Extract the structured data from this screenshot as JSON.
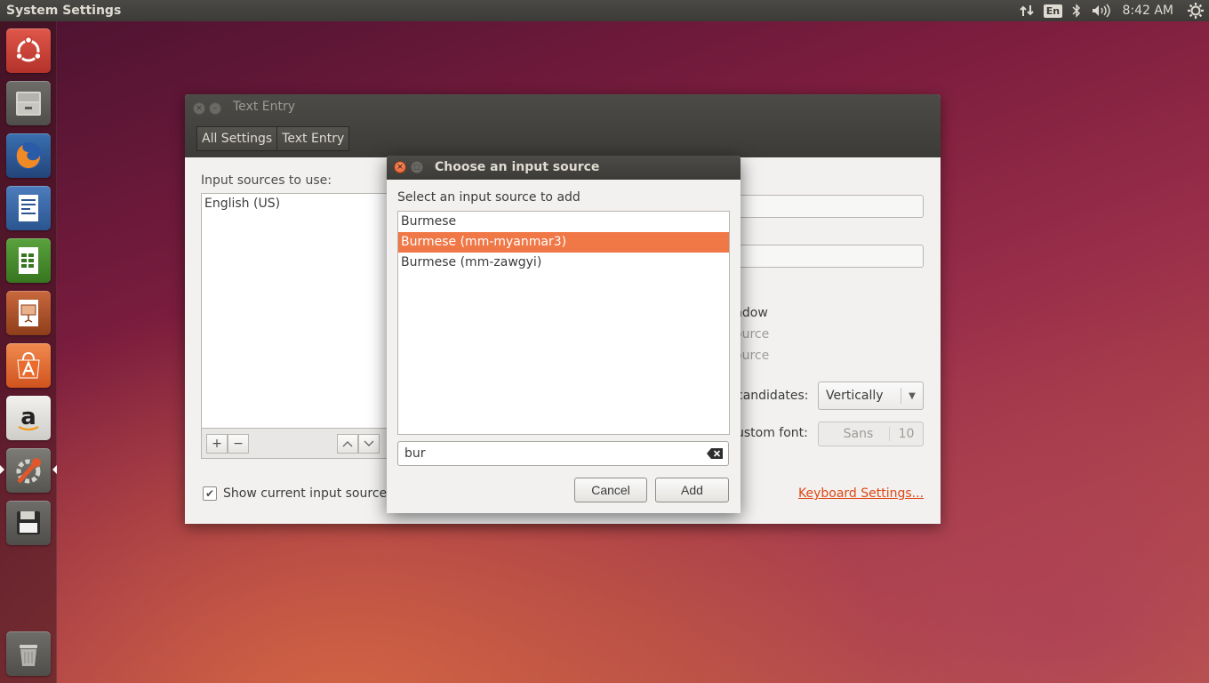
{
  "top_panel": {
    "app_title": "System Settings",
    "keyboard_indicator": "En",
    "clock": "8:42 AM"
  },
  "launcher": {
    "items": [
      "ubuntu-dash-icon",
      "files-icon",
      "firefox-icon",
      "writer-icon",
      "calc-icon",
      "impress-icon",
      "software-center-icon",
      "amazon-icon",
      "system-settings-icon",
      "save-icon",
      "trash-icon"
    ]
  },
  "main_window": {
    "title": "Text Entry",
    "breadcrumbs": [
      "All Settings",
      "Text Entry"
    ],
    "sources_label": "Input sources to use:",
    "sources": [
      "English (US)"
    ],
    "show_current_label": "Show current input source in",
    "show_current_checked": true,
    "partial_labels": {
      "a": "s",
      "b": "ndow",
      "c": "ource",
      "d": "ource",
      "candidates": "candidates:",
      "custom_font": "ustom font:"
    },
    "candidates_value": "Vertically",
    "font_name": "Sans",
    "font_size": "10",
    "keyboard_settings_link": "Keyboard Settings..."
  },
  "dialog": {
    "title": "Choose an input source",
    "prompt": "Select an input source to add",
    "options": [
      {
        "label": "Burmese",
        "selected": false
      },
      {
        "label": "Burmese (mm-myanmar3)",
        "selected": true
      },
      {
        "label": "Burmese (mm-zawgyi)",
        "selected": false
      }
    ],
    "search_value": "bur",
    "cancel_label": "Cancel",
    "add_label": "Add"
  },
  "colors": {
    "accent": "#f07746",
    "link": "#dd4814",
    "panel": "#3c3b37"
  }
}
